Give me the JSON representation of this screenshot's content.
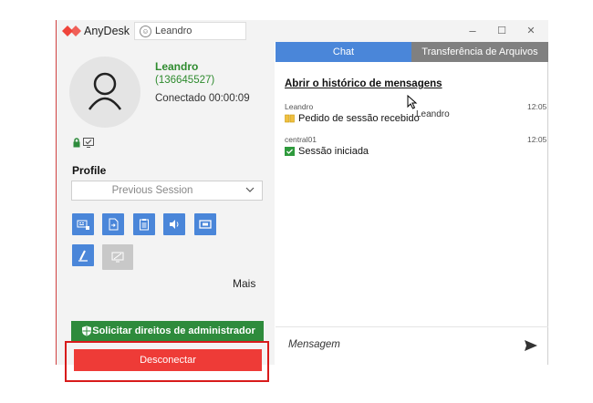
{
  "titlebar": {
    "app_name": "AnyDesk",
    "tab_label": "Leandro",
    "minimize": "–",
    "maximize": "☐",
    "close": "✕"
  },
  "session": {
    "name": "Leandro",
    "id": "(136645527)",
    "status": "Conectado 00:00:09"
  },
  "profile": {
    "heading": "Profile",
    "selected": "Previous Session"
  },
  "actions": {
    "more_label": "Mais",
    "admin_label": "Solicitar direitos de administrador",
    "disconnect_label": "Desconectar"
  },
  "tabs": {
    "chat": "Chat",
    "files": "Transferência de Arquivos"
  },
  "chat": {
    "history_link": "Abrir o histórico de mensagens",
    "messages": [
      {
        "sender": "Leandro",
        "time": "12:05",
        "text": "Pedido de sessão recebido"
      },
      {
        "sender": "central01",
        "time": "12:05",
        "text": "Sessão iniciada"
      }
    ],
    "tooltip": "Leandro",
    "input_placeholder": "Mensagem"
  },
  "colors": {
    "accent_blue": "#4a86d9",
    "green": "#2e8b3c",
    "red": "#ee3b37"
  }
}
